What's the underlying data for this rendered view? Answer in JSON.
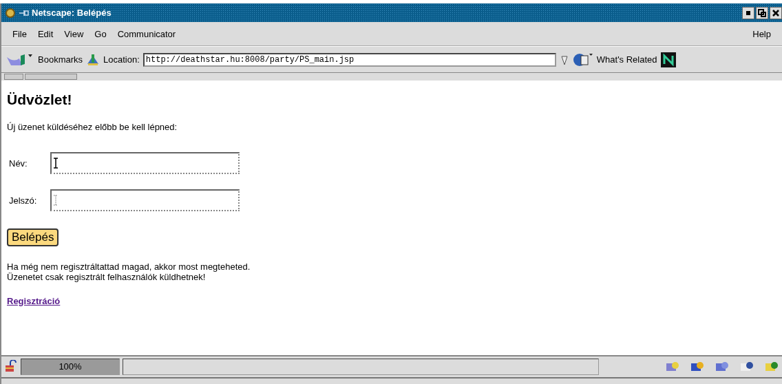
{
  "window": {
    "title": "Netscape: Belépés"
  },
  "menu": [
    "File",
    "Edit",
    "View",
    "Go",
    "Communicator"
  ],
  "help_menu": "Help",
  "location_bar": {
    "bookmarks": "Bookmarks",
    "location_label": "Location:",
    "url": "http://deathstar.hu:8008/party/PS_main.jsp",
    "whats_related": "What's Related"
  },
  "page": {
    "heading": "Üdvözlet!",
    "intro": "Új üzenet küldéséhez előbb be kell lépned:",
    "fields": [
      {
        "label": "Név:",
        "focused": true
      },
      {
        "label": "Jelszó:",
        "focused": false
      }
    ],
    "login_button": "Belépés",
    "notes": [
      "Ha még nem regisztráltattad magad, akkor most megteheted.",
      "Üzenetet csak regisztrált felhasználók küldhetnek!"
    ],
    "register_link": "Regisztráció"
  },
  "status_bar": {
    "progress": {
      "reading": "100%",
      "level": 1
    }
  }
}
